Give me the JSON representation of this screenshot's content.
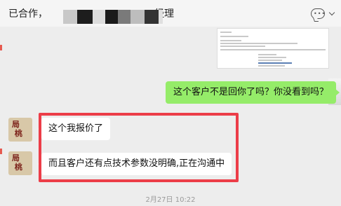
{
  "header": {
    "title_left": "已合作，",
    "title_right": "经理",
    "actions": [
      "chat-bubble-icon",
      "chevron-down-icon"
    ]
  },
  "messages": [
    {
      "from": "me",
      "type": "image",
      "desc": "document-screenshot"
    },
    {
      "from": "me",
      "type": "text",
      "text": "这个客户不是回你了吗？你没看到吗？"
    },
    {
      "from": "contact",
      "type": "text",
      "text": "这个我报价了",
      "avatar_text": "局 桃"
    },
    {
      "from": "contact",
      "type": "text",
      "text": "而且客户还有点技术参数没明确,正在沟通中",
      "avatar_text": "局 桃"
    }
  ],
  "timestamp": "2月27日 10:22",
  "colors": {
    "sent_bubble": "#95ec69",
    "received_bubble": "#ffffff",
    "background": "#ededed",
    "highlight_box": "#ec3d48"
  }
}
